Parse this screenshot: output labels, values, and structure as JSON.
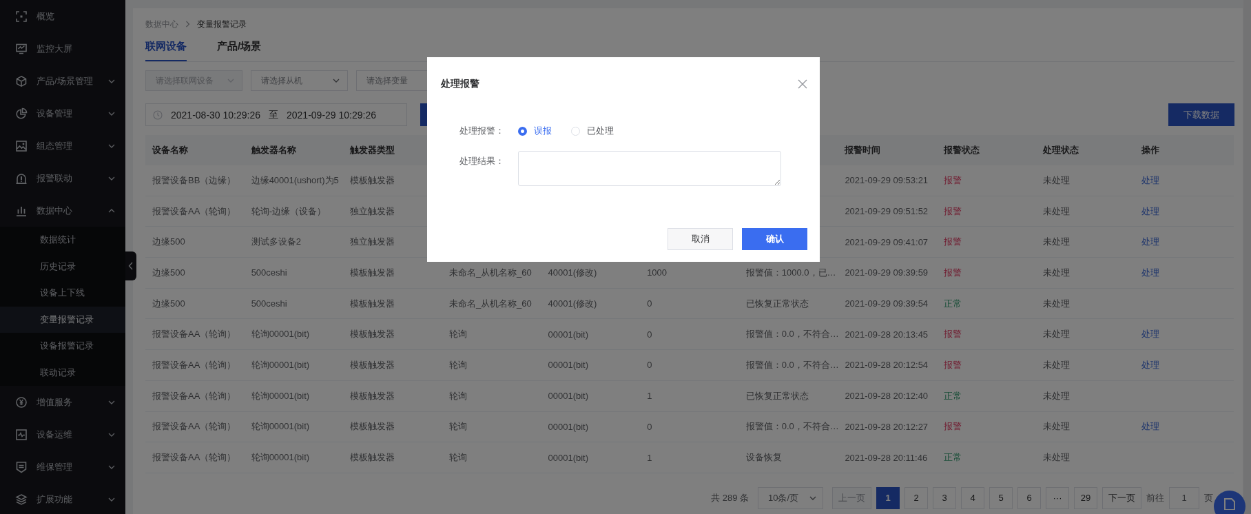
{
  "sidebar": {
    "items": [
      {
        "label": "概览",
        "kind": "link"
      },
      {
        "label": "监控大屏",
        "kind": "link"
      },
      {
        "label": "产品/场景管理",
        "kind": "group",
        "expanded": false
      },
      {
        "label": "设备管理",
        "kind": "group",
        "expanded": false
      },
      {
        "label": "组态管理",
        "kind": "group",
        "expanded": false
      },
      {
        "label": "报警联动",
        "kind": "group",
        "expanded": false
      },
      {
        "label": "数据中心",
        "kind": "group",
        "expanded": true,
        "children": [
          {
            "label": "数据统计",
            "selected": false
          },
          {
            "label": "历史记录",
            "selected": false
          },
          {
            "label": "设备上下线",
            "selected": false
          },
          {
            "label": "变量报警记录",
            "selected": true
          },
          {
            "label": "设备报警记录",
            "selected": false
          },
          {
            "label": "联动记录",
            "selected": false
          }
        ]
      },
      {
        "label": "增值服务",
        "kind": "group",
        "expanded": false
      },
      {
        "label": "设备运维",
        "kind": "group",
        "expanded": false
      },
      {
        "label": "维保管理",
        "kind": "group",
        "expanded": false
      },
      {
        "label": "扩展功能",
        "kind": "group",
        "expanded": false
      }
    ]
  },
  "breadcrumb": [
    "数据中心",
    "变量报警记录"
  ],
  "tabs": [
    {
      "label": "联网设备",
      "selected": true
    },
    {
      "label": "产品/场景",
      "selected": false
    }
  ],
  "filters": [
    {
      "placeholder": "请选择联网设备",
      "disabled": true
    },
    {
      "placeholder": "请选择从机",
      "disabled": false
    },
    {
      "placeholder": "请选择变量",
      "disabled": false
    }
  ],
  "date_range": {
    "start": "2021-08-30 10:29:26",
    "separator": "至",
    "end": "2021-09-29 10:29:26"
  },
  "download_button": "下载数据",
  "table": {
    "columns": [
      "设备名称",
      "触发器名称",
      "触发器类型",
      null,
      null,
      null,
      null,
      "报警时间",
      "报警状态",
      "处理状态",
      "操作"
    ],
    "rows": [
      {
        "kind": "alarm",
        "cells": [
          "报警设备BB（边缘）",
          "边缘40001(ushort)为5",
          "模板触发器",
          null,
          null,
          null,
          null,
          "2021-09-29 09:53:21",
          "报警",
          "未处理",
          "处理"
        ]
      },
      {
        "kind": "alarm",
        "cells": [
          "报警设备AA（轮询）",
          "轮询-边缘（设备）",
          "独立触发器",
          null,
          null,
          null,
          null,
          "2021-09-29 09:51:52",
          "报警",
          "未处理",
          "处理"
        ]
      },
      {
        "kind": "alarm",
        "cells": [
          "边缘500",
          "测试多设备2",
          "独立触发器",
          null,
          null,
          null,
          null,
          "2021-09-29 09:41:07",
          "报警",
          "未处理",
          "处理"
        ]
      },
      {
        "kind": "alarm",
        "cells": [
          "边缘500",
          "500ceshi",
          "模板触发器",
          "未命名_从机名称_60",
          "40001(修改)",
          "1000",
          "报警值：1000.0，已…",
          "2021-09-29 09:39:59",
          "报警",
          "未处理",
          "处理"
        ]
      },
      {
        "kind": "normal",
        "cells": [
          "边缘500",
          "500ceshi",
          "模板触发器",
          "未命名_从机名称_60",
          "40001(修改)",
          "0",
          "已恢复正常状态",
          "2021-09-29 09:39:54",
          "正常",
          "未处理",
          null
        ]
      },
      {
        "kind": "alarm",
        "cells": [
          "报警设备AA（轮询）",
          "轮询00001(bit)",
          "模板触发器",
          "轮询",
          "00001(bit)",
          "0",
          "报警值：0.0，不符合…",
          "2021-09-28 20:13:45",
          "报警",
          "未处理",
          "处理"
        ]
      },
      {
        "kind": "alarm",
        "cells": [
          "报警设备AA（轮询）",
          "轮询00001(bit)",
          "模板触发器",
          "轮询",
          "00001(bit)",
          "0",
          "报警值：0.0，不符合…",
          "2021-09-28 20:12:54",
          "报警",
          "未处理",
          "处理"
        ]
      },
      {
        "kind": "normal",
        "cells": [
          "报警设备AA（轮询）",
          "轮询00001(bit)",
          "模板触发器",
          "轮询",
          "00001(bit)",
          "1",
          "已恢复正常状态",
          "2021-09-28 20:12:40",
          "正常",
          "未处理",
          null
        ]
      },
      {
        "kind": "alarm",
        "cells": [
          "报警设备AA（轮询）",
          "轮询00001(bit)",
          "模板触发器",
          "轮询",
          "00001(bit)",
          "0",
          "报警值：0.0，不符合…",
          "2021-09-28 20:12:27",
          "报警",
          "未处理",
          "处理"
        ]
      },
      {
        "kind": "normal",
        "cells": [
          "报警设备AA（轮询）",
          "轮询00001(bit)",
          "模板触发器",
          "轮询",
          "00001(bit)",
          "1",
          "设备恢复",
          "2021-09-28 20:11:46",
          "正常",
          "未处理",
          null
        ]
      }
    ]
  },
  "pagination": {
    "total": "共 289 条",
    "page_size": "10条/页",
    "prev": {
      "label": "上一页",
      "disabled": true
    },
    "pages": [
      {
        "label": "1",
        "selected": true
      },
      {
        "label": "2",
        "selected": false
      },
      {
        "label": "3",
        "selected": false
      },
      {
        "label": "4",
        "selected": false
      },
      {
        "label": "5",
        "selected": false
      },
      {
        "label": "6",
        "selected": false
      },
      {
        "label": "···",
        "selected": false
      },
      {
        "label": "29",
        "selected": false
      }
    ],
    "next": {
      "label": "下一页",
      "disabled": false
    },
    "goto_label": "前往",
    "goto_value": "1",
    "goto_suffix": "页"
  },
  "modal": {
    "title": "处理报警",
    "fields": [
      {
        "kind": "radio",
        "label": "处理报警：",
        "options": [
          {
            "label": "误报",
            "selected": true
          },
          {
            "label": "已处理",
            "selected": false
          }
        ]
      },
      {
        "kind": "textarea",
        "label": "处理结果："
      }
    ],
    "buttons": [
      {
        "label": "取消",
        "kind": "default"
      },
      {
        "label": "确认",
        "kind": "primary"
      }
    ]
  }
}
